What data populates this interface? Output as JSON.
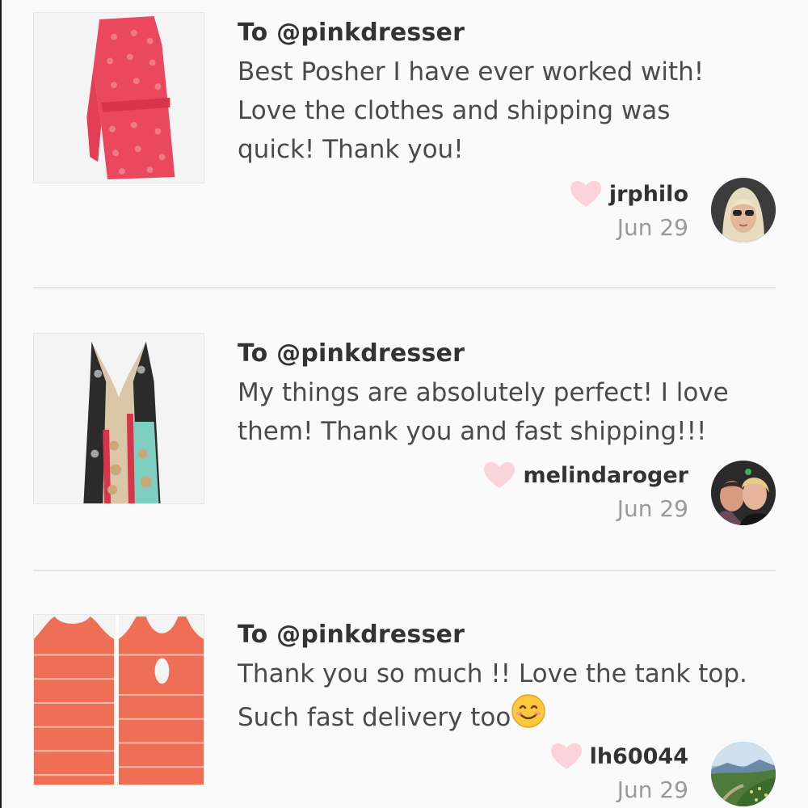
{
  "reviews": [
    {
      "to": "To @pinkdresser",
      "message": "Best Posher I have ever worked with! Love the clothes and shipping was quick! Thank you!",
      "username": "jrphilo",
      "date": "Jun 29",
      "product_icon": "pink-one-shoulder-dress-photo",
      "avatar_icon": "woman-sunglasses-avatar"
    },
    {
      "to": "To @pinkdresser",
      "message": "My things are absolutely perfect! I love them! Thank you and fast shipping!!!",
      "username": "melindaroger",
      "date": "Jun 29",
      "product_icon": "paisley-halter-top-photo",
      "avatar_icon": "couple-selfie-avatar"
    },
    {
      "to": "To @pinkdresser",
      "message": "Thank you so much !! Love the tank top. Such fast delivery too",
      "emoji": "smiling-face-emoji",
      "username": "lh60044",
      "date": "Jun 29",
      "product_icon": "coral-tank-top-photos",
      "avatar_icon": "landscape-avatar"
    }
  ],
  "colors": {
    "heart": "#fbd3db",
    "divider": "#e3e3e3",
    "date": "#9a9a9a",
    "background": "#fbfafb"
  }
}
